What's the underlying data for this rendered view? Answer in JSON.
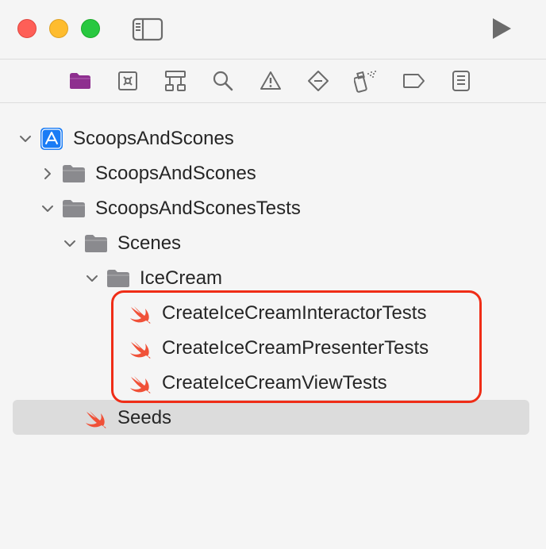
{
  "window": {
    "controls": [
      "close",
      "minimize",
      "zoom"
    ]
  },
  "navigator_tabs": [
    {
      "name": "project-navigator",
      "icon": "folder-icon",
      "active": true
    },
    {
      "name": "source-control-navigator",
      "icon": "source-control-icon",
      "active": false
    },
    {
      "name": "symbol-navigator",
      "icon": "hierarchy-icon",
      "active": false
    },
    {
      "name": "find-navigator",
      "icon": "search-icon",
      "active": false
    },
    {
      "name": "issue-navigator",
      "icon": "warning-icon",
      "active": false
    },
    {
      "name": "test-navigator",
      "icon": "test-diamond-icon",
      "active": false
    },
    {
      "name": "debug-navigator",
      "icon": "spray-icon",
      "active": false
    },
    {
      "name": "breakpoint-navigator",
      "icon": "breakpoint-tag-icon",
      "active": false
    },
    {
      "name": "report-navigator",
      "icon": "report-list-icon",
      "active": false
    }
  ],
  "tree": {
    "root": {
      "label": "ScoopsAndScones",
      "expanded": true
    },
    "items": [
      {
        "label": "ScoopsAndScones",
        "type": "folder",
        "expanded": false
      },
      {
        "label": "ScoopsAndSconesTests",
        "type": "folder",
        "expanded": true
      },
      {
        "label": "Scenes",
        "type": "folder",
        "expanded": true
      },
      {
        "label": "IceCream",
        "type": "folder",
        "expanded": true
      },
      {
        "label": "CreateIceCreamInteractorTests",
        "type": "swift"
      },
      {
        "label": "CreateIceCreamPresenterTests",
        "type": "swift"
      },
      {
        "label": "CreateIceCreamViewTests",
        "type": "swift"
      },
      {
        "label": "Seeds",
        "type": "swift",
        "selected": true
      }
    ]
  },
  "colors": {
    "accent_purple": "#8e2f8f",
    "swift_orange": "#f05138",
    "highlight_red": "#ef2d17",
    "folder_gray": "#8a8a8e",
    "app_blue": "#1a7cf5"
  }
}
